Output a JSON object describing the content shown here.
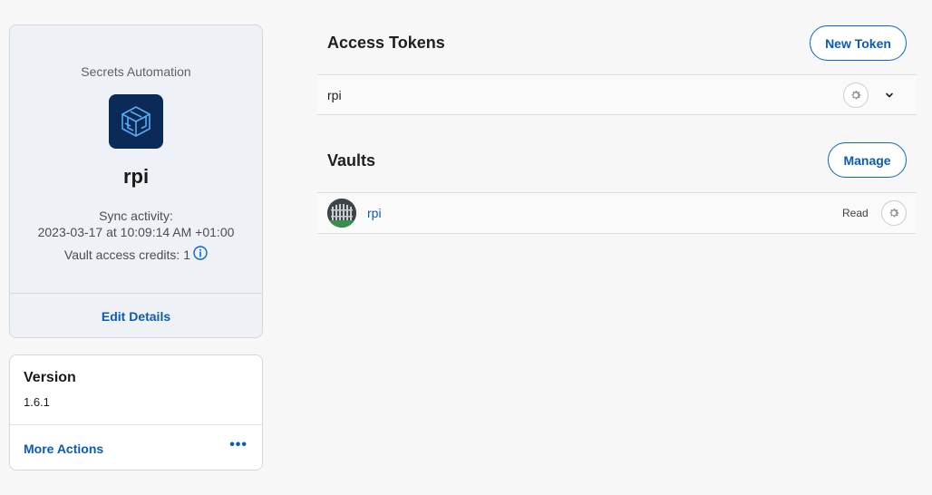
{
  "automation": {
    "section_label": "Secrets Automation",
    "icon": "secrets-automation-cube-icon",
    "name": "rpi",
    "sync_label": "Sync activity:",
    "sync_value": "2023-03-17 at 10:09:14 AM +01:00",
    "credits_label": "Vault access credits:",
    "credits_value": "1",
    "edit_label": "Edit Details"
  },
  "version": {
    "title": "Version",
    "value": "1.6.1",
    "more_actions_label": "More Actions",
    "more_icon": "ellipsis-icon"
  },
  "access_tokens": {
    "title": "Access Tokens",
    "new_button_label": "New Token",
    "items": [
      {
        "name": "rpi"
      }
    ]
  },
  "vaults": {
    "title": "Vaults",
    "manage_button_label": "Manage",
    "items": [
      {
        "name": "rpi",
        "permission": "Read",
        "avatar": "vault-avatar-image"
      }
    ]
  },
  "colors": {
    "accent": "#0a5bb5",
    "card_bg": "#eef1f6",
    "app_icon_bg": "#0b2a57"
  }
}
